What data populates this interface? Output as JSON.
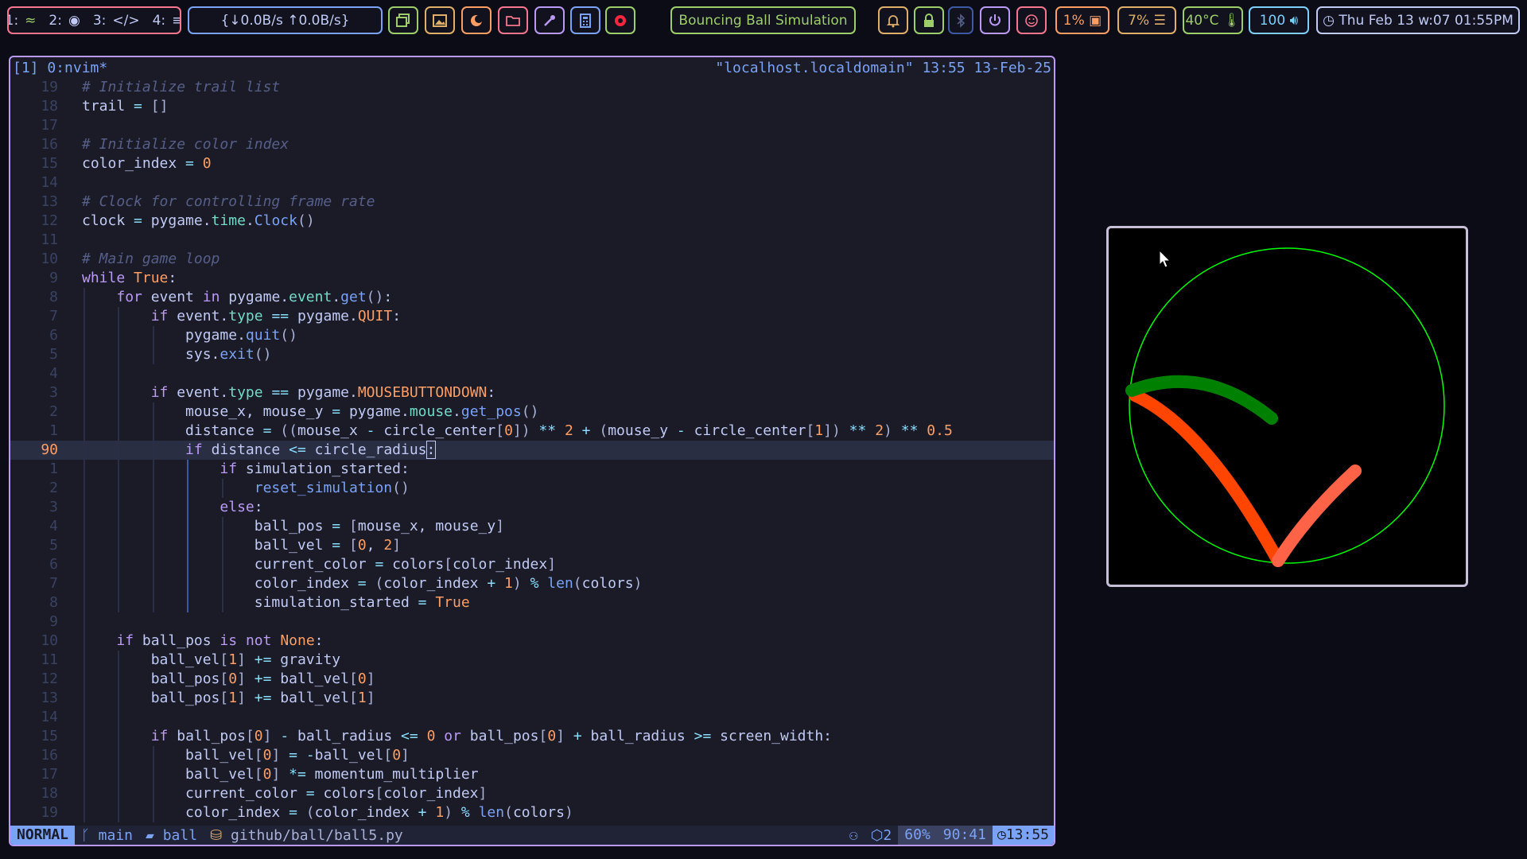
{
  "topbar": {
    "workspaces": [
      {
        "num": "1:",
        "icon": "chameleon-icon"
      },
      {
        "num": "2:",
        "icon": "firefox-icon"
      },
      {
        "num": "3:",
        "icon": "code-icon"
      },
      {
        "num": "4:",
        "icon": "spotify-icon"
      }
    ],
    "workspace_glyphs": [
      "≈",
      "◉",
      "</>",
      "≡"
    ],
    "network": "{↓0.0B/s ↑0.0B/s}",
    "window_title": "Bouncing Ball Simulation",
    "cpu": "1%",
    "memory": "7%",
    "temperature": "40°C",
    "volume": "100",
    "datetime": "Thu Feb 13 w:07 01:55PM"
  },
  "tmux": {
    "left": "[1] 0:nvim*",
    "right": "\"localhost.localdomain\" 13:55 13-Feb-25"
  },
  "editor": {
    "lines": [
      {
        "n": "19",
        "t": "# Initialize trail list"
      },
      {
        "n": "18",
        "t": "trail = []"
      },
      {
        "n": "17",
        "t": ""
      },
      {
        "n": "16",
        "t": "# Initialize color index"
      },
      {
        "n": "15",
        "t": "color_index = 0"
      },
      {
        "n": "14",
        "t": ""
      },
      {
        "n": "13",
        "t": "# Clock for controlling frame rate"
      },
      {
        "n": "12",
        "t": "clock = pygame.time.Clock()"
      },
      {
        "n": "11",
        "t": ""
      },
      {
        "n": "10",
        "t": "# Main game loop"
      },
      {
        "n": "9",
        "t": "while True:"
      },
      {
        "n": "8",
        "t": "    for event in pygame.event.get():"
      },
      {
        "n": "7",
        "t": "        if event.type == pygame.QUIT:"
      },
      {
        "n": "6",
        "t": "            pygame.quit()"
      },
      {
        "n": "5",
        "t": "            sys.exit()"
      },
      {
        "n": "4",
        "t": ""
      },
      {
        "n": "3",
        "t": "        if event.type == pygame.MOUSEBUTTONDOWN:"
      },
      {
        "n": "2",
        "t": "            mouse_x, mouse_y = pygame.mouse.get_pos()"
      },
      {
        "n": "1",
        "t": "            distance = ((mouse_x - circle_center[0]) ** 2 + (mouse_y - circle_center[1]) ** 2) ** 0.5"
      },
      {
        "n": "90",
        "t": "            if distance <= circle_radius:"
      },
      {
        "n": "1",
        "t": "                if simulation_started:"
      },
      {
        "n": "2",
        "t": "                    reset_simulation()"
      },
      {
        "n": "3",
        "t": "                else:"
      },
      {
        "n": "4",
        "t": "                    ball_pos = [mouse_x, mouse_y]"
      },
      {
        "n": "5",
        "t": "                    ball_vel = [0, 2]"
      },
      {
        "n": "6",
        "t": "                    current_color = colors[color_index]"
      },
      {
        "n": "7",
        "t": "                    color_index = (color_index + 1) % len(colors)"
      },
      {
        "n": "8",
        "t": "                    simulation_started = True"
      },
      {
        "n": "9",
        "t": ""
      },
      {
        "n": "10",
        "t": "    if ball_pos is not None:"
      },
      {
        "n": "11",
        "t": "        ball_vel[1] += gravity"
      },
      {
        "n": "12",
        "t": "        ball_pos[0] += ball_vel[0]"
      },
      {
        "n": "13",
        "t": "        ball_pos[1] += ball_vel[1]"
      },
      {
        "n": "14",
        "t": ""
      },
      {
        "n": "15",
        "t": "        if ball_pos[0] - ball_radius <= 0 or ball_pos[0] + ball_radius >= screen_width:"
      },
      {
        "n": "16",
        "t": "            ball_vel[0] = -ball_vel[0]"
      },
      {
        "n": "17",
        "t": "            ball_vel[0] *= momentum_multiplier"
      },
      {
        "n": "18",
        "t": "            current_color = colors[color_index]"
      },
      {
        "n": "19",
        "t": "            color_index = (color_index + 1) % len(colors)"
      }
    ],
    "current_line_index": 19
  },
  "statusline": {
    "mode": "NORMAL",
    "branch": "main",
    "folder": "ball",
    "file": "github/ball/ball5.py",
    "lsp_count": "2",
    "percent": "60%",
    "position": "90:41",
    "time": "13:55"
  },
  "colors": {
    "accent": "#7aa2f7",
    "background": "#1a1b26",
    "circle": "#00ff00",
    "trail_orange": "#ff4500",
    "trail_salmon": "#ff6347",
    "trail_green": "#008000"
  }
}
